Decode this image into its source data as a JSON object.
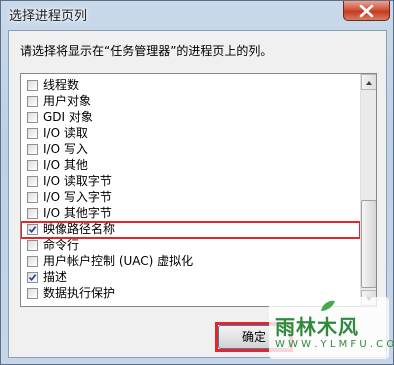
{
  "window": {
    "title": "选择进程页列",
    "close_icon": "close-icon"
  },
  "instruction": "请选择将显示在“任务管理器”的进程页上的列。",
  "columns": [
    {
      "label": "线程数",
      "checked": false
    },
    {
      "label": "用户对象",
      "checked": false
    },
    {
      "label": "GDI 对象",
      "checked": false
    },
    {
      "label": "I/O 读取",
      "checked": false
    },
    {
      "label": "I/O 写入",
      "checked": false
    },
    {
      "label": "I/O 其他",
      "checked": false
    },
    {
      "label": "I/O 读取字节",
      "checked": false
    },
    {
      "label": "I/O 写入字节",
      "checked": false
    },
    {
      "label": "I/O 其他字节",
      "checked": false
    },
    {
      "label": "映像路径名称",
      "checked": true,
      "highlighted": true
    },
    {
      "label": "命令行",
      "checked": false
    },
    {
      "label": "用户帐户控制 (UAC) 虚拟化",
      "checked": false
    },
    {
      "label": "描述",
      "checked": true
    },
    {
      "label": "数据执行保护",
      "checked": false
    }
  ],
  "buttons": {
    "ok_label": "确定"
  },
  "watermark": {
    "main": "雨林木风",
    "url": "W W W . Y L M F U . C O M"
  },
  "colors": {
    "highlight": "#e3262c",
    "close_button": "#c43a21",
    "watermark": "#2f8a3c"
  }
}
